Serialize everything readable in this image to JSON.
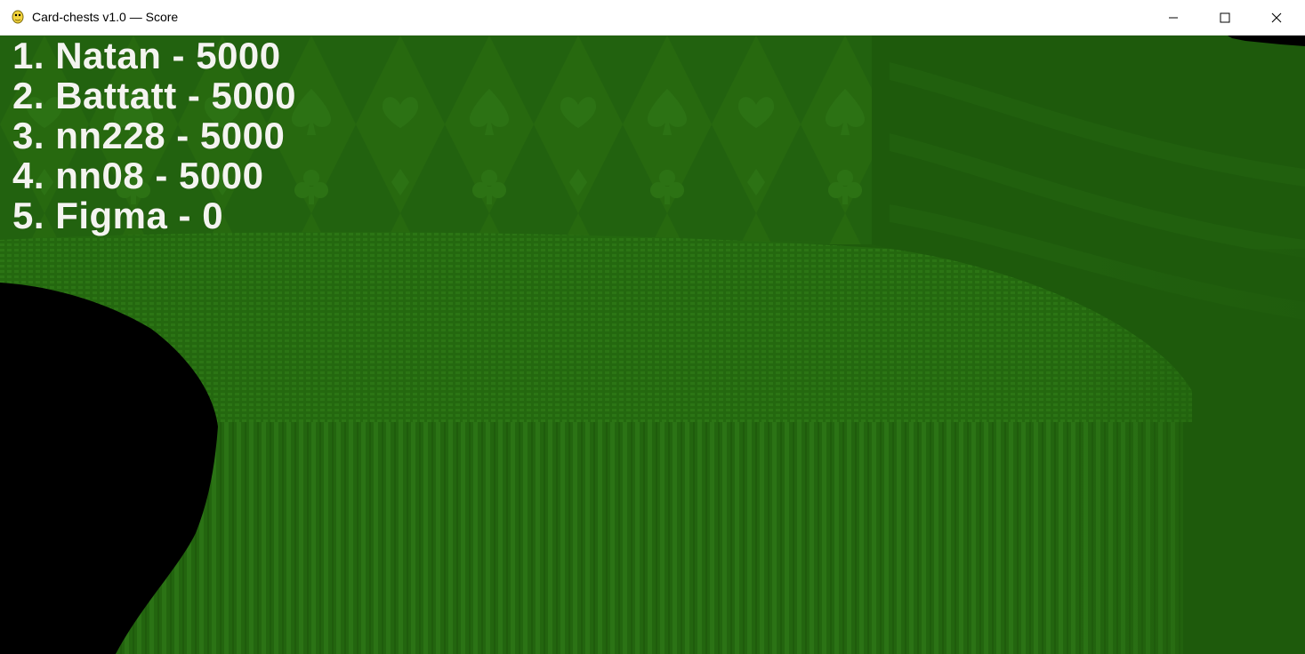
{
  "window": {
    "title": "Card-chests v1.0 — Score",
    "app_icon": "python-snake-icon",
    "controls": [
      "minimize-icon",
      "maximize-icon",
      "close-icon"
    ]
  },
  "scoreboard": {
    "entries": [
      "1. Natan - 5000",
      "2. Battatt - 5000",
      "3. nn228 - 5000",
      "4. nn08 - 5000",
      "5. Figma - 0"
    ]
  },
  "colors": {
    "felt": "#1e5a0c",
    "felt_light": "#2a7014",
    "pattern": "#2e7a16",
    "void": "#000000",
    "score_text": "#f4f4f0"
  }
}
